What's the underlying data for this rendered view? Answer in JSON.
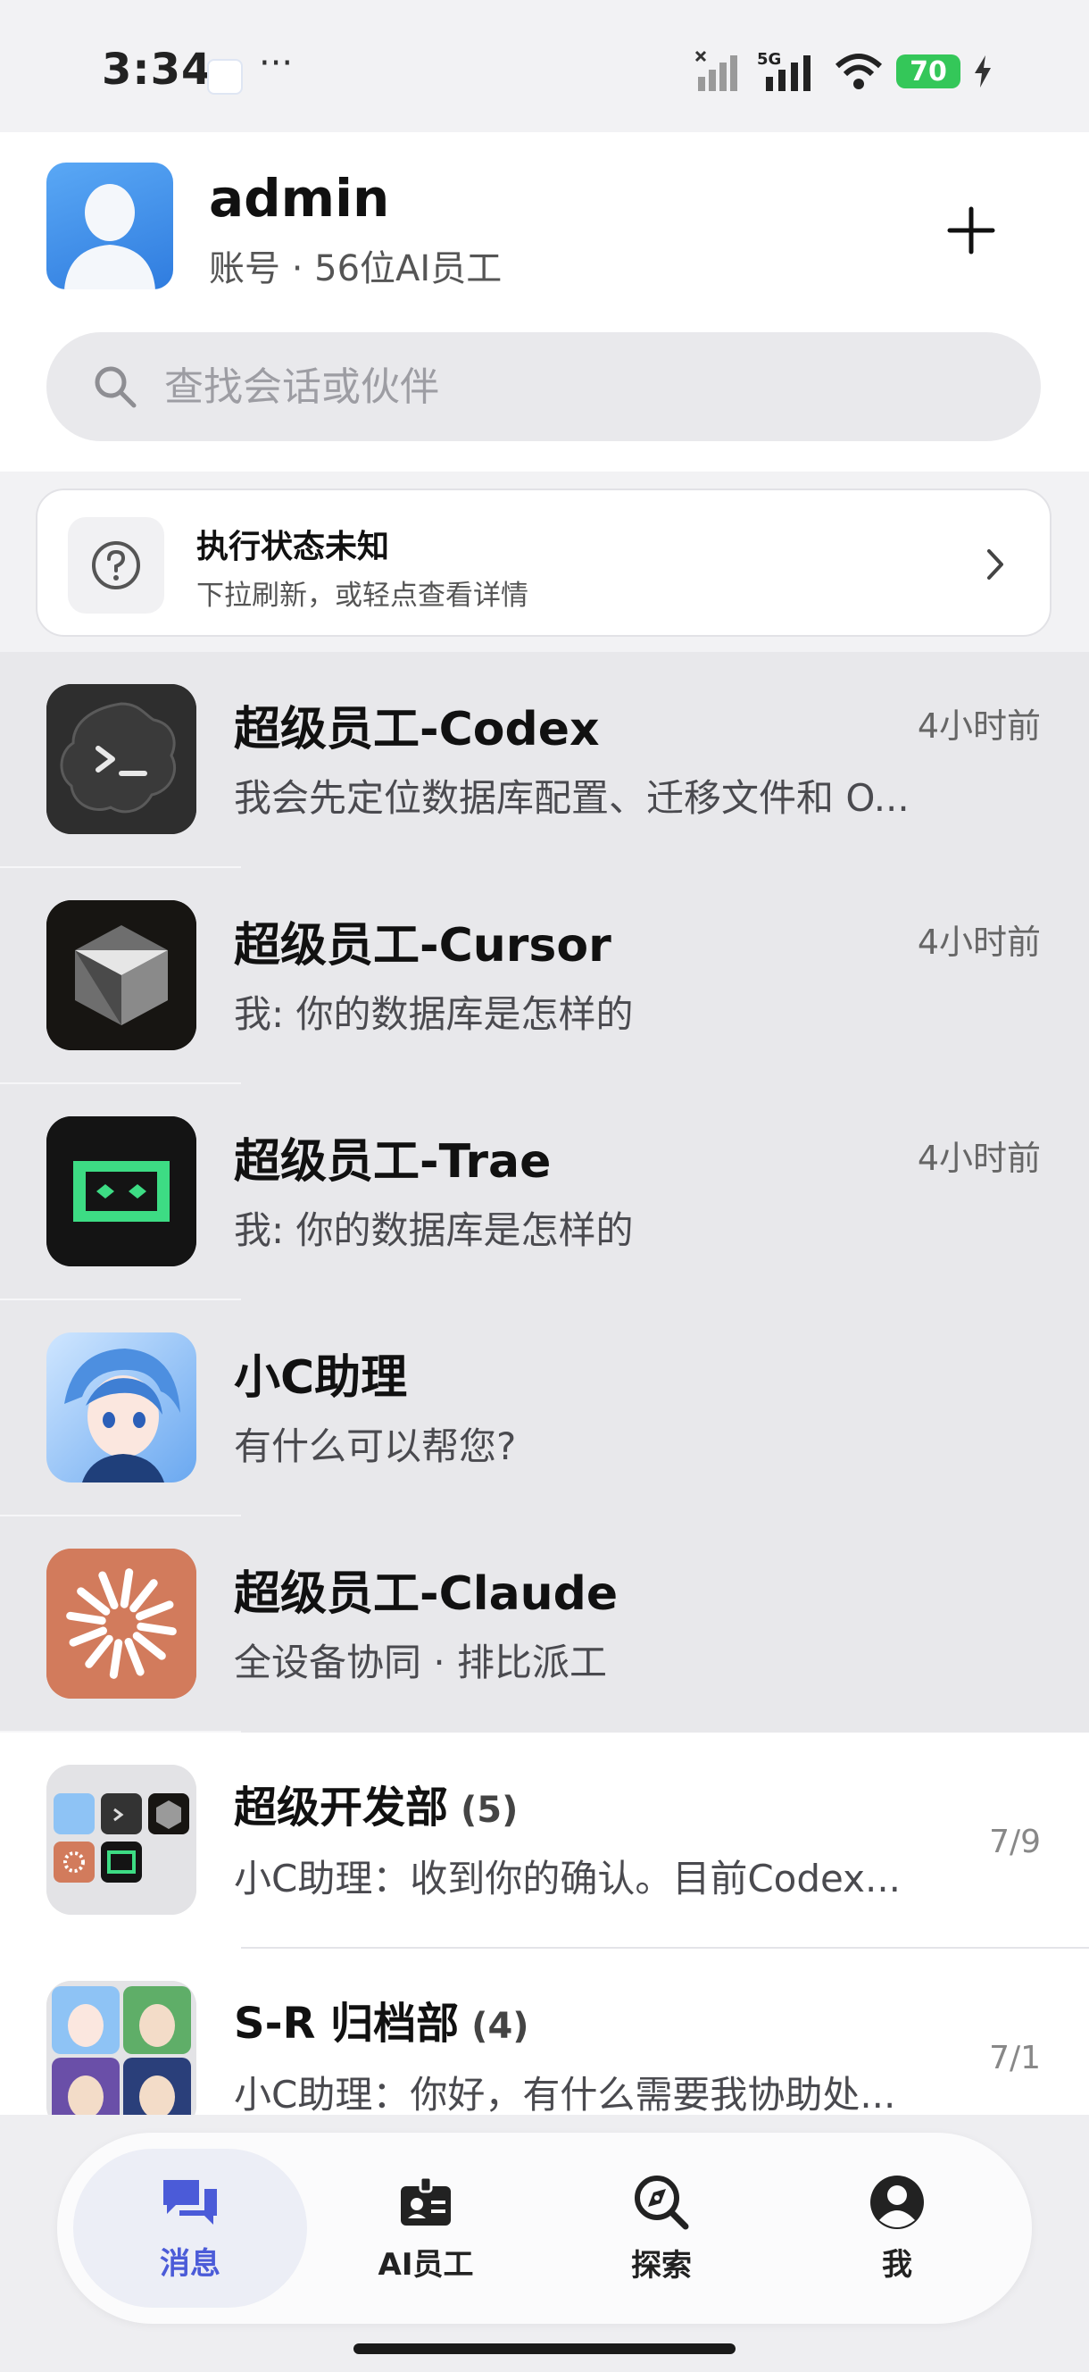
{
  "status_bar": {
    "time": "3:34",
    "dots": "···",
    "network": "5G",
    "battery": "70"
  },
  "header": {
    "username": "admin",
    "subtitle": "账号 · 56位AI员工",
    "add_button": "+"
  },
  "search": {
    "placeholder": "查找会话或伙伴"
  },
  "notice": {
    "title": "执行状态未知",
    "subtitle": "下拉刷新，或轻点查看详情"
  },
  "chats": [
    {
      "name": "超级员工-Codex",
      "preview": "我会先定位数据库配置、迁移文件和 O...",
      "time": "4小时前"
    },
    {
      "name": "超级员工-Cursor",
      "preview": "我: 你的数据库是怎样的",
      "time": "4小时前"
    },
    {
      "name": "超级员工-Trae",
      "preview": "我: 你的数据库是怎样的",
      "time": "4小时前"
    },
    {
      "name": "小C助理",
      "preview": "有什么可以帮您?",
      "time": ""
    },
    {
      "name": "超级员工-Claude",
      "preview": "全设备协同 · 排比派工",
      "time": ""
    },
    {
      "name": "超级开发部",
      "count": "(5)",
      "preview": "小C助理：收到你的确认。目前Codex...",
      "time": "7/9"
    },
    {
      "name": "S-R 归档部",
      "count": "(4)",
      "preview": "小C助理：你好，有什么需要我协助处...",
      "time": "7/1"
    }
  ],
  "tabs": [
    {
      "label": "消息",
      "icon": "chat-bubbles-icon"
    },
    {
      "label": "AI员工",
      "icon": "badge-icon"
    },
    {
      "label": "探索",
      "icon": "explore-icon"
    },
    {
      "label": "我",
      "icon": "user-icon"
    }
  ],
  "colors": {
    "accent": "#4b5bd8",
    "battery": "#34c759",
    "claude": "#d27b5c",
    "trae": "#3ddc84"
  }
}
